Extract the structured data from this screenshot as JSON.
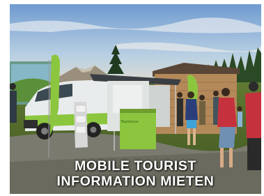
{
  "caption": {
    "line1": "MOBILE TOURIST",
    "line2": "INFORMATION MIETEN"
  },
  "counter_sign": {
    "text": "Tourismus"
  },
  "colors": {
    "brand_green": "#8cc63f",
    "van_body": "#e9ecec",
    "sky_top": "#6f9bd0",
    "grass": "#5f7a32"
  }
}
